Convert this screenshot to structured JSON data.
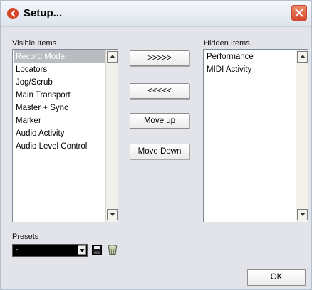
{
  "window": {
    "title": "Setup...",
    "accent_color": "#d64a2a",
    "close_icon": "close-icon"
  },
  "visible_items": {
    "label": "Visible Items",
    "items": [
      "Record Mode",
      "Locators",
      "Jog/Scrub",
      "Main Transport",
      "Master + Sync",
      "Marker",
      "Audio Activity",
      "Audio Level Control"
    ],
    "selected": "Record Mode"
  },
  "hidden_items": {
    "label": "Hidden Items",
    "items": [
      "Performance",
      "MIDI Activity"
    ]
  },
  "buttons": {
    "move_right": ">>>>>",
    "move_left": "<<<<<",
    "move_up": "Move up",
    "move_down": "Move Down",
    "ok": "OK"
  },
  "presets": {
    "label": "Presets",
    "value": "-"
  },
  "icons": [
    "app-icon",
    "close-icon",
    "scroll-up-arrow-icon",
    "scroll-down-arrow-icon",
    "dropdown-arrow-icon",
    "save-disk-icon",
    "delete-trash-icon"
  ]
}
